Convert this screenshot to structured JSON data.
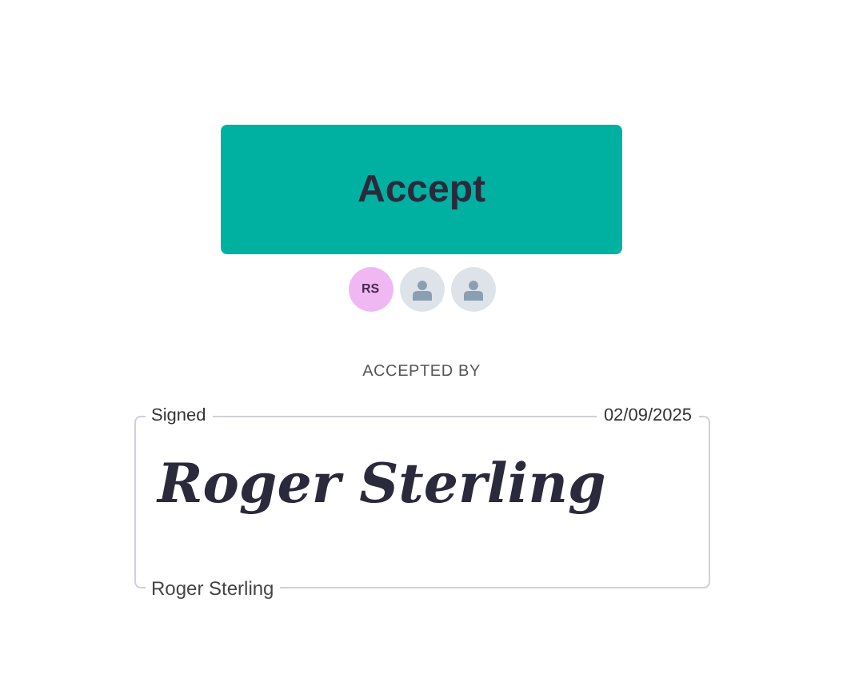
{
  "accept_button": {
    "label": "Accept"
  },
  "signers": [
    {
      "kind": "initials",
      "initials": "RS",
      "color": "#f0b8f2"
    },
    {
      "kind": "placeholder",
      "color": "#dde3e9"
    },
    {
      "kind": "placeholder",
      "color": "#dde3e9"
    }
  ],
  "accepted_by": {
    "heading": "ACCEPTED BY",
    "status": "Signed",
    "date": "02/09/2025",
    "signature": "Roger Sterling",
    "name": "Roger Sterling"
  }
}
